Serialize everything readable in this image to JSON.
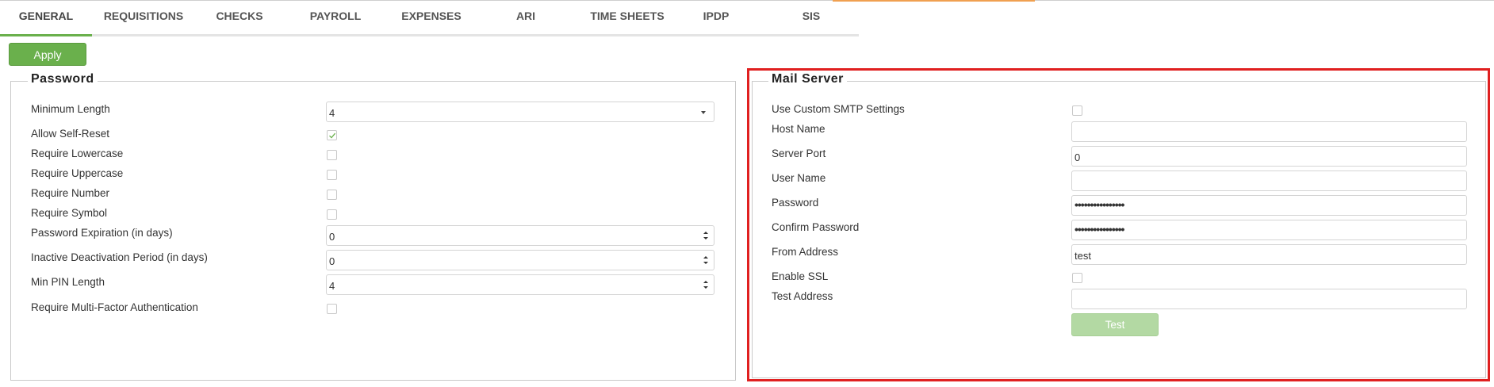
{
  "tabs": [
    {
      "label": "GENERAL",
      "active": true
    },
    {
      "label": "REQUISITIONS"
    },
    {
      "label": "CHECKS"
    },
    {
      "label": "PAYROLL"
    },
    {
      "label": "EXPENSES"
    },
    {
      "label": "ARI"
    },
    {
      "label": "TIME SHEETS"
    },
    {
      "label": "IPDP"
    },
    {
      "label": "SIS"
    }
  ],
  "toolbar": {
    "apply_label": "Apply"
  },
  "password": {
    "title": "Password",
    "min_length": {
      "label": "Minimum Length",
      "value": "4"
    },
    "allow_self_reset": {
      "label": "Allow Self-Reset",
      "checked": true
    },
    "require_lowercase": {
      "label": "Require Lowercase",
      "checked": false
    },
    "require_uppercase": {
      "label": "Require Uppercase",
      "checked": false
    },
    "require_number": {
      "label": "Require Number",
      "checked": false
    },
    "require_symbol": {
      "label": "Require Symbol",
      "checked": false
    },
    "expiration": {
      "label": "Password Expiration (in days)",
      "value": "0"
    },
    "inactive": {
      "label": "Inactive Deactivation Period (in days)",
      "value": "0"
    },
    "min_pin": {
      "label": "Min PIN Length",
      "value": "4"
    },
    "mfa": {
      "label": "Require Multi-Factor Authentication",
      "checked": false
    }
  },
  "mail": {
    "title": "Mail Server",
    "custom_smtp": {
      "label": "Use Custom SMTP Settings",
      "checked": false
    },
    "host": {
      "label": "Host Name",
      "value": ""
    },
    "port": {
      "label": "Server Port",
      "value": "0"
    },
    "user": {
      "label": "User Name",
      "value": ""
    },
    "password": {
      "label": "Password",
      "value": "••••••••••••••••"
    },
    "confirm": {
      "label": "Confirm Password",
      "value": "••••••••••••••••"
    },
    "from": {
      "label": "From Address",
      "value": "test"
    },
    "ssl": {
      "label": "Enable SSL",
      "checked": false
    },
    "test_address": {
      "label": "Test Address",
      "value": ""
    },
    "test_label": "Test"
  },
  "colors": {
    "accent": "#6ab04c",
    "highlight": "#e02020",
    "disabled_button": "#b3d9a3"
  }
}
